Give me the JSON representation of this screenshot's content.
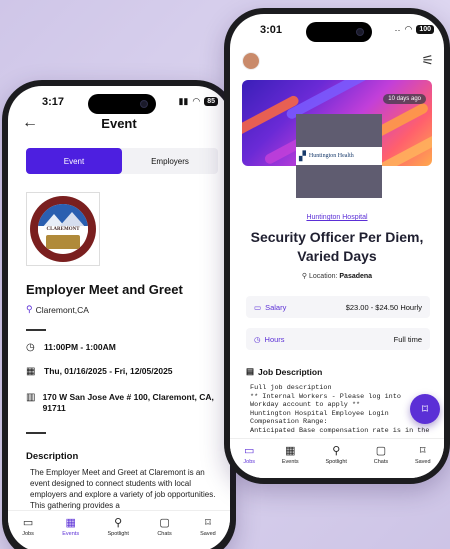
{
  "left": {
    "status_time": "3:17",
    "battery": "85",
    "header_title": "Event",
    "segments": [
      "Event",
      "Employers"
    ],
    "seal_text": "CLAREMONT",
    "event_title": "Employer Meet and Greet",
    "location": "Claremont,CA",
    "time": "11:00PM - 1:00AM",
    "dates": "Thu, 01/16/2025 - Fri, 12/05/2025",
    "address": "170 W San Jose Ave # 100, Claremont, CA, 91711",
    "description_heading": "Description",
    "description": "The Employer Meet and Greet at Claremont is an event designed to connect students with local employers and explore a variety of job opportunities. This gathering provides a",
    "tabs": [
      "Jobs",
      "Events",
      "Spotlight",
      "Chats",
      "Saved"
    ],
    "active_tab": "Events"
  },
  "right": {
    "status_time": "3:01",
    "battery": "100",
    "days_badge": "10 days ago",
    "logo_text": "Huntington Health",
    "company": "Huntington Hospital",
    "job_title": "Security Officer Per Diem, Varied Days",
    "location_label": "Location:",
    "location_value": "Pasadena",
    "salary_label": "Salary",
    "salary_value": "$23.00 - $24.50 Hourly",
    "hours_label": "Hours",
    "hours_value": "Full time",
    "jd_heading": "Job Description",
    "jd_lines": [
      "Full job description",
      "** Internal Workers - Please log into",
      "Workday account to apply **",
      "Huntington Hospital Employee Login",
      "Compensation Range:",
      "Anticipated Base compensation rate is in the"
    ],
    "tabs": [
      "Jobs",
      "Events",
      "Spotlight",
      "Chats",
      "Saved"
    ],
    "active_tab": "Jobs"
  },
  "colors": {
    "accent": "#5b2fd6",
    "segment_active": "#4d1fe0"
  },
  "icons": {
    "tabs": [
      "briefcase-icon",
      "calendar-icon",
      "spotlight-icon",
      "chat-icon",
      "bookmark-icon"
    ]
  }
}
